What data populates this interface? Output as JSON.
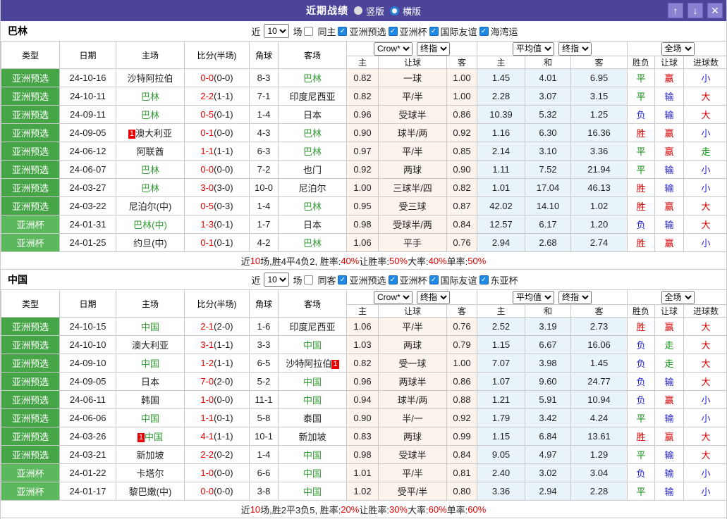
{
  "titlebar": {
    "title": "近期战绩",
    "radios": [
      {
        "label": "竖版",
        "selected": false
      },
      {
        "label": "横版",
        "selected": true
      }
    ],
    "buttons": [
      {
        "name": "move-up-button",
        "glyph": "↑"
      },
      {
        "name": "move-down-button",
        "glyph": "↓"
      },
      {
        "name": "close-button",
        "glyph": "✕"
      }
    ]
  },
  "filter_labels": {
    "near": "近",
    "count": "10",
    "games": "场"
  },
  "table_header": {
    "static_cols": [
      "类型",
      "日期",
      "主场",
      "比分(半场)",
      "角球",
      "客场"
    ],
    "odds_dropdowns": [
      "Crow*",
      "终指"
    ],
    "avg_dropdowns": [
      "平均值",
      "终指"
    ],
    "scope_dropdown": "全场",
    "sub_cols": [
      "主",
      "让球",
      "客",
      "主",
      "和",
      "客",
      "胜负",
      "让球",
      "进球数"
    ]
  },
  "colors": {
    "titlebar_purple": "#4b4499",
    "badge_green": "#46a546",
    "badge_light_green": "#5cb85c",
    "focal_team_green": "#339933",
    "score_red": "#e60000",
    "odds_bg": "#fcf3ec",
    "avg_bg": "#e9f4fa",
    "win_red": "#d50000",
    "draw_green": "#0b8f0b",
    "lose_blue": "#2323cc",
    "checkbox_blue": "#1e88e5"
  },
  "sections": [
    {
      "team": "巴林",
      "same_checkbox": "同主",
      "same_checked": false,
      "league_checkboxes": [
        "亚洲预选",
        "亚洲杯",
        "国际友谊",
        "海湾运"
      ],
      "rows": [
        {
          "type": "亚洲预选",
          "date": "24-10-16",
          "home": "沙特阿拉伯",
          "homeFocal": false,
          "homeMark": "",
          "score": "0-0",
          "half": "(0-0)",
          "corner": "8-3",
          "away": "巴林",
          "awayFocal": true,
          "awayMark": "",
          "o1": "0.82",
          "line": "一球",
          "o2": "1.00",
          "a1": "1.45",
          "a2": "4.01",
          "a3": "6.95",
          "r1": "平",
          "r2": "赢",
          "r3": "小"
        },
        {
          "type": "亚洲预选",
          "date": "24-10-11",
          "home": "巴林",
          "homeFocal": true,
          "homeMark": "",
          "score": "2-2",
          "half": "(1-1)",
          "corner": "7-1",
          "away": "印度尼西亚",
          "awayFocal": false,
          "awayMark": "",
          "o1": "0.82",
          "line": "平/半",
          "o2": "1.00",
          "a1": "2.28",
          "a2": "3.07",
          "a3": "3.15",
          "r1": "平",
          "r2": "输",
          "r3": "大"
        },
        {
          "type": "亚洲预选",
          "date": "24-09-11",
          "home": "巴林",
          "homeFocal": true,
          "homeMark": "",
          "score": "0-5",
          "half": "(0-1)",
          "corner": "1-4",
          "away": "日本",
          "awayFocal": false,
          "awayMark": "",
          "o1": "0.96",
          "line": "受球半",
          "o2": "0.86",
          "a1": "10.39",
          "a2": "5.32",
          "a3": "1.25",
          "r1": "负",
          "r2": "输",
          "r3": "大"
        },
        {
          "type": "亚洲预选",
          "date": "24-09-05",
          "home": "澳大利亚",
          "homeFocal": false,
          "homeMark": "1",
          "score": "0-1",
          "half": "(0-0)",
          "corner": "4-3",
          "away": "巴林",
          "awayFocal": true,
          "awayMark": "",
          "o1": "0.90",
          "line": "球半/两",
          "o2": "0.92",
          "a1": "1.16",
          "a2": "6.30",
          "a3": "16.36",
          "r1": "胜",
          "r2": "赢",
          "r3": "小"
        },
        {
          "type": "亚洲预选",
          "date": "24-06-12",
          "home": "阿联酋",
          "homeFocal": false,
          "homeMark": "",
          "score": "1-1",
          "half": "(1-1)",
          "corner": "6-3",
          "away": "巴林",
          "awayFocal": true,
          "awayMark": "",
          "o1": "0.97",
          "line": "平/半",
          "o2": "0.85",
          "a1": "2.14",
          "a2": "3.10",
          "a3": "3.36",
          "r1": "平",
          "r2": "赢",
          "r3": "走"
        },
        {
          "type": "亚洲预选",
          "date": "24-06-07",
          "home": "巴林",
          "homeFocal": true,
          "homeMark": "",
          "score": "0-0",
          "half": "(0-0)",
          "corner": "7-2",
          "away": "也门",
          "awayFocal": false,
          "awayMark": "",
          "o1": "0.92",
          "line": "两球",
          "o2": "0.90",
          "a1": "1.11",
          "a2": "7.52",
          "a3": "21.94",
          "r1": "平",
          "r2": "输",
          "r3": "小"
        },
        {
          "type": "亚洲预选",
          "date": "24-03-27",
          "home": "巴林",
          "homeFocal": true,
          "homeMark": "",
          "score": "3-0",
          "half": "(3-0)",
          "corner": "10-0",
          "away": "尼泊尔",
          "awayFocal": false,
          "awayMark": "",
          "o1": "1.00",
          "line": "三球半/四",
          "o2": "0.82",
          "a1": "1.01",
          "a2": "17.04",
          "a3": "46.13",
          "r1": "胜",
          "r2": "输",
          "r3": "小"
        },
        {
          "type": "亚洲预选",
          "date": "24-03-22",
          "home": "尼泊尔(中)",
          "homeFocal": false,
          "homeMark": "",
          "score": "0-5",
          "half": "(0-3)",
          "corner": "1-4",
          "away": "巴林",
          "awayFocal": true,
          "awayMark": "",
          "o1": "0.95",
          "line": "受三球",
          "o2": "0.87",
          "a1": "42.02",
          "a2": "14.10",
          "a3": "1.02",
          "r1": "胜",
          "r2": "赢",
          "r3": "大"
        },
        {
          "type": "亚洲杯",
          "date": "24-01-31",
          "home": "巴林(中)",
          "homeFocal": true,
          "homeMark": "",
          "score": "1-3",
          "half": "(0-1)",
          "corner": "1-7",
          "away": "日本",
          "awayFocal": false,
          "awayMark": "",
          "o1": "0.98",
          "line": "受球半/两",
          "o2": "0.84",
          "a1": "12.57",
          "a2": "6.17",
          "a3": "1.20",
          "r1": "负",
          "r2": "输",
          "r3": "大"
        },
        {
          "type": "亚洲杯",
          "date": "24-01-25",
          "home": "约旦(中)",
          "homeFocal": false,
          "homeMark": "",
          "score": "0-1",
          "half": "(0-1)",
          "corner": "4-2",
          "away": "巴林",
          "awayFocal": true,
          "awayMark": "",
          "o1": "1.06",
          "line": "平手",
          "o2": "0.76",
          "a1": "2.94",
          "a2": "2.68",
          "a3": "2.74",
          "r1": "胜",
          "r2": "赢",
          "r3": "小"
        }
      ],
      "summary": [
        [
          "近",
          false
        ],
        [
          "10",
          true
        ],
        [
          "场,胜4平4负2, 胜率:",
          false
        ],
        [
          "40%",
          true
        ],
        [
          " 让胜率:",
          false
        ],
        [
          "50%",
          true
        ],
        [
          " 大率:",
          false
        ],
        [
          "40%",
          true
        ],
        [
          " 单率:",
          false
        ],
        [
          "50%",
          true
        ]
      ]
    },
    {
      "team": "中国",
      "same_checkbox": "同客",
      "same_checked": false,
      "league_checkboxes": [
        "亚洲预选",
        "亚洲杯",
        "国际友谊",
        "东亚杯"
      ],
      "rows": [
        {
          "type": "亚洲预选",
          "date": "24-10-15",
          "home": "中国",
          "homeFocal": true,
          "homeMark": "",
          "score": "2-1",
          "half": "(2-0)",
          "corner": "1-6",
          "away": "印度尼西亚",
          "awayFocal": false,
          "awayMark": "",
          "o1": "1.06",
          "line": "平/半",
          "o2": "0.76",
          "a1": "2.52",
          "a2": "3.19",
          "a3": "2.73",
          "r1": "胜",
          "r2": "赢",
          "r3": "大"
        },
        {
          "type": "亚洲预选",
          "date": "24-10-10",
          "home": "澳大利亚",
          "homeFocal": false,
          "homeMark": "",
          "score": "3-1",
          "half": "(1-1)",
          "corner": "3-3",
          "away": "中国",
          "awayFocal": true,
          "awayMark": "",
          "o1": "1.03",
          "line": "两球",
          "o2": "0.79",
          "a1": "1.15",
          "a2": "6.67",
          "a3": "16.06",
          "r1": "负",
          "r2": "走",
          "r3": "大"
        },
        {
          "type": "亚洲预选",
          "date": "24-09-10",
          "home": "中国",
          "homeFocal": true,
          "homeMark": "",
          "score": "1-2",
          "half": "(1-1)",
          "corner": "6-5",
          "away": "沙特阿拉伯",
          "awayFocal": false,
          "awayMark": "1",
          "o1": "0.82",
          "line": "受一球",
          "o2": "1.00",
          "a1": "7.07",
          "a2": "3.98",
          "a3": "1.45",
          "r1": "负",
          "r2": "走",
          "r3": "大"
        },
        {
          "type": "亚洲预选",
          "date": "24-09-05",
          "home": "日本",
          "homeFocal": false,
          "homeMark": "",
          "score": "7-0",
          "half": "(2-0)",
          "corner": "5-2",
          "away": "中国",
          "awayFocal": true,
          "awayMark": "",
          "o1": "0.96",
          "line": "两球半",
          "o2": "0.86",
          "a1": "1.07",
          "a2": "9.60",
          "a3": "24.77",
          "r1": "负",
          "r2": "输",
          "r3": "大"
        },
        {
          "type": "亚洲预选",
          "date": "24-06-11",
          "home": "韩国",
          "homeFocal": false,
          "homeMark": "",
          "score": "1-0",
          "half": "(0-0)",
          "corner": "11-1",
          "away": "中国",
          "awayFocal": true,
          "awayMark": "",
          "o1": "0.94",
          "line": "球半/两",
          "o2": "0.88",
          "a1": "1.21",
          "a2": "5.91",
          "a3": "10.94",
          "r1": "负",
          "r2": "赢",
          "r3": "小"
        },
        {
          "type": "亚洲预选",
          "date": "24-06-06",
          "home": "中国",
          "homeFocal": true,
          "homeMark": "",
          "score": "1-1",
          "half": "(0-1)",
          "corner": "5-8",
          "away": "泰国",
          "awayFocal": false,
          "awayMark": "",
          "o1": "0.90",
          "line": "半/一",
          "o2": "0.92",
          "a1": "1.79",
          "a2": "3.42",
          "a3": "4.24",
          "r1": "平",
          "r2": "输",
          "r3": "小"
        },
        {
          "type": "亚洲预选",
          "date": "24-03-26",
          "home": "中国",
          "homeFocal": true,
          "homeMark": "1",
          "score": "4-1",
          "half": "(1-1)",
          "corner": "10-1",
          "away": "新加坡",
          "awayFocal": false,
          "awayMark": "",
          "o1": "0.83",
          "line": "两球",
          "o2": "0.99",
          "a1": "1.15",
          "a2": "6.84",
          "a3": "13.61",
          "r1": "胜",
          "r2": "赢",
          "r3": "大"
        },
        {
          "type": "亚洲预选",
          "date": "24-03-21",
          "home": "新加坡",
          "homeFocal": false,
          "homeMark": "",
          "score": "2-2",
          "half": "(0-2)",
          "corner": "1-4",
          "away": "中国",
          "awayFocal": true,
          "awayMark": "",
          "o1": "0.98",
          "line": "受球半",
          "o2": "0.84",
          "a1": "9.05",
          "a2": "4.97",
          "a3": "1.29",
          "r1": "平",
          "r2": "输",
          "r3": "大"
        },
        {
          "type": "亚洲杯",
          "date": "24-01-22",
          "home": "卡塔尔",
          "homeFocal": false,
          "homeMark": "",
          "score": "1-0",
          "half": "(0-0)",
          "corner": "6-6",
          "away": "中国",
          "awayFocal": true,
          "awayMark": "",
          "o1": "1.01",
          "line": "平/半",
          "o2": "0.81",
          "a1": "2.40",
          "a2": "3.02",
          "a3": "3.04",
          "r1": "负",
          "r2": "输",
          "r3": "小"
        },
        {
          "type": "亚洲杯",
          "date": "24-01-17",
          "home": "黎巴嫩(中)",
          "homeFocal": false,
          "homeMark": "",
          "score": "0-0",
          "half": "(0-0)",
          "corner": "3-8",
          "away": "中国",
          "awayFocal": true,
          "awayMark": "",
          "o1": "1.02",
          "line": "受平/半",
          "o2": "0.80",
          "a1": "3.36",
          "a2": "2.94",
          "a3": "2.28",
          "r1": "平",
          "r2": "输",
          "r3": "小"
        }
      ],
      "summary": [
        [
          "近",
          false
        ],
        [
          "10",
          true
        ],
        [
          "场,胜2平3负5, 胜率:",
          false
        ],
        [
          "20%",
          true
        ],
        [
          " 让胜率:",
          false
        ],
        [
          "30%",
          true
        ],
        [
          " 大率:",
          false
        ],
        [
          "60%",
          true
        ],
        [
          " 单率:",
          false
        ],
        [
          "60%",
          true
        ]
      ]
    }
  ]
}
